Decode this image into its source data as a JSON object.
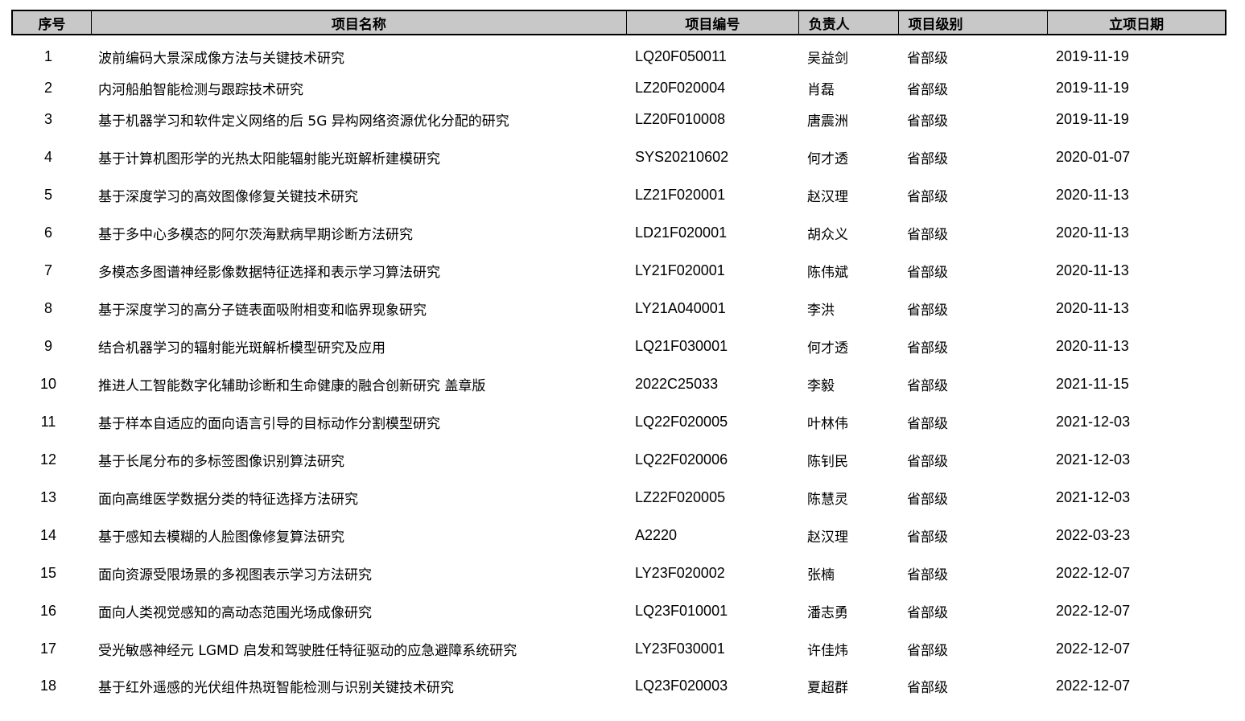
{
  "table": {
    "headers": [
      "序号",
      "项目名称",
      "项目编号",
      "负责人",
      "项目级别",
      "立项日期"
    ],
    "rows": [
      {
        "seq": "1",
        "name": "波前编码大景深成像方法与关键技术研究",
        "code": "LQ20F050011",
        "lead": "吴益剑",
        "level": "省部级",
        "date": "2019-11-19"
      },
      {
        "seq": "2",
        "name": "内河船舶智能检测与跟踪技术研究",
        "code": "LZ20F020004",
        "lead": "肖磊",
        "level": "省部级",
        "date": "2019-11-19"
      },
      {
        "seq": "3",
        "name": "基于机器学习和软件定义网络的后 5G 异构网络资源优化分配的研究",
        "code": "LZ20F010008",
        "lead": "唐震洲",
        "level": "省部级",
        "date": "2019-11-19"
      },
      {
        "seq": "4",
        "name": "基于计算机图形学的光热太阳能辐射能光斑解析建模研究",
        "code": "SYS20210602",
        "lead": "何才透",
        "level": "省部级",
        "date": "2020-01-07"
      },
      {
        "seq": "5",
        "name": "基于深度学习的高效图像修复关键技术研究",
        "code": "LZ21F020001",
        "lead": "赵汉理",
        "level": "省部级",
        "date": "2020-11-13"
      },
      {
        "seq": "6",
        "name": "基于多中心多模态的阿尔茨海默病早期诊断方法研究",
        "code": "LD21F020001",
        "lead": "胡众义",
        "level": "省部级",
        "date": "2020-11-13"
      },
      {
        "seq": "7",
        "name": "多模态多图谱神经影像数据特征选择和表示学习算法研究",
        "code": "LY21F020001",
        "lead": "陈伟斌",
        "level": "省部级",
        "date": "2020-11-13"
      },
      {
        "seq": "8",
        "name": "基于深度学习的高分子链表面吸附相变和临界现象研究",
        "code": "LY21A040001",
        "lead": "李洪",
        "level": "省部级",
        "date": "2020-11-13"
      },
      {
        "seq": "9",
        "name": "结合机器学习的辐射能光斑解析模型研究及应用",
        "code": "LQ21F030001",
        "lead": "何才透",
        "level": "省部级",
        "date": "2020-11-13"
      },
      {
        "seq": "10",
        "name": "推进人工智能数字化辅助诊断和生命健康的融合创新研究  盖章版",
        "code": "2022C25033",
        "lead": "李毅",
        "level": "省部级",
        "date": "2021-11-15"
      },
      {
        "seq": "11",
        "name": "基于样本自适应的面向语言引导的目标动作分割模型研究",
        "code": "LQ22F020005",
        "lead": "叶林伟",
        "level": "省部级",
        "date": "2021-12-03"
      },
      {
        "seq": "12",
        "name": "基于长尾分布的多标签图像识别算法研究",
        "code": "LQ22F020006",
        "lead": "陈钊民",
        "level": "省部级",
        "date": "2021-12-03"
      },
      {
        "seq": "13",
        "name": "面向高维医学数据分类的特征选择方法研究",
        "code": "LZ22F020005",
        "lead": "陈慧灵",
        "level": "省部级",
        "date": "2021-12-03"
      },
      {
        "seq": "14",
        "name": "基于感知去模糊的人脸图像修复算法研究",
        "code": "A2220",
        "lead": "赵汉理",
        "level": "省部级",
        "date": "2022-03-23"
      },
      {
        "seq": "15",
        "name": "面向资源受限场景的多视图表示学习方法研究",
        "code": "LY23F020002",
        "lead": "张楠",
        "level": "省部级",
        "date": "2022-12-07"
      },
      {
        "seq": "16",
        "name": "面向人类视觉感知的高动态范围光场成像研究",
        "code": "LQ23F010001",
        "lead": "潘志勇",
        "level": "省部级",
        "date": "2022-12-07"
      },
      {
        "seq": "17",
        "name": "受光敏感神经元 LGMD 启发和驾驶胜任特征驱动的应急避障系统研究",
        "code": "LY23F030001",
        "lead": "许佳炜",
        "level": "省部级",
        "date": "2022-12-07"
      },
      {
        "seq": "18",
        "name": "基于红外遥感的光伏组件热斑智能检测与识别关键技术研究",
        "code": "LQ23F020003",
        "lead": "夏超群",
        "level": "省部级",
        "date": "2022-12-07"
      }
    ]
  }
}
